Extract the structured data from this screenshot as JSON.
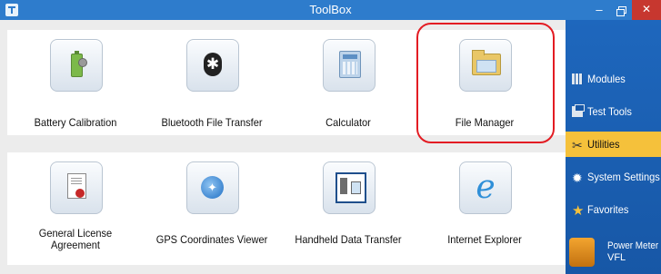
{
  "window": {
    "title": "ToolBox",
    "min_glyph": "–",
    "close_glyph": "✕"
  },
  "tools": [
    {
      "label": "Battery Calibration",
      "icon": "battery-icon"
    },
    {
      "label": "Bluetooth File Transfer",
      "icon": "bluetooth-icon",
      "glyph": "✱"
    },
    {
      "label": "Calculator",
      "icon": "calculator-icon"
    },
    {
      "label": "File Manager",
      "icon": "file-manager-icon",
      "highlighted": true
    },
    {
      "label_line1": "General License",
      "label_line2": "Agreement",
      "icon": "license-icon"
    },
    {
      "label": "GPS Coordinates Viewer",
      "icon": "gps-icon",
      "glyph": "✦"
    },
    {
      "label": "Handheld Data Transfer",
      "icon": "handheld-icon"
    },
    {
      "label": "Internet Explorer",
      "icon": "internet-explorer-icon",
      "glyph": "e"
    }
  ],
  "sidebar": {
    "items": [
      {
        "label": "Modules",
        "icon": "modules-icon"
      },
      {
        "label": "Test Tools",
        "icon": "test-tools-icon"
      },
      {
        "label": "Utilities",
        "icon": "utilities-icon",
        "glyph": "✂",
        "selected": true
      },
      {
        "label": "System Settings",
        "icon": "settings-gear-icon",
        "glyph": "✹"
      },
      {
        "label": "Favorites",
        "icon": "star-icon",
        "glyph": "★"
      }
    ],
    "power": {
      "line1": "Power Meter",
      "line2": "VFL",
      "icon": "power-meter-icon"
    }
  },
  "colors": {
    "titlebar": "#2e7ccc",
    "sidebar": "#1e67bd",
    "selected": "#f5c13b",
    "highlight": "#e31c23",
    "close": "#c7372f"
  }
}
